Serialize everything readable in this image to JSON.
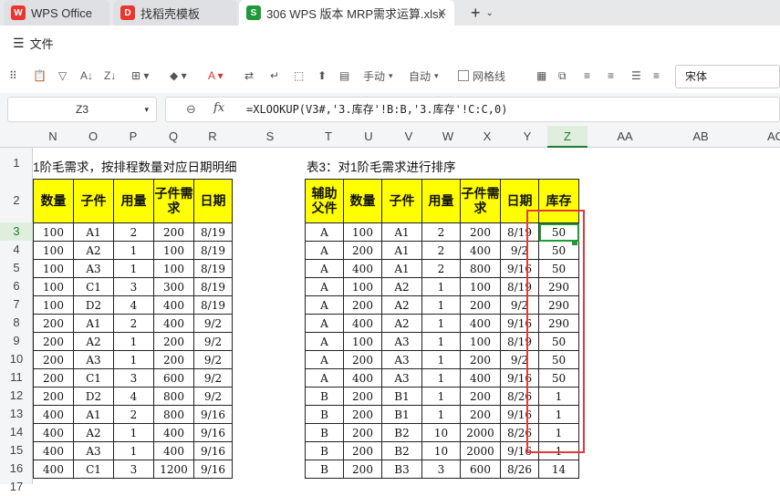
{
  "tabs": [
    {
      "label": "WPS Office",
      "icon": "wps-icon"
    },
    {
      "label": "找稻壳模板",
      "icon": "docer-icon"
    },
    {
      "label": "306 WPS 版本 MRP需求运算.xlsx",
      "icon": "spreadsheet-icon"
    }
  ],
  "menu": {
    "file": "文件"
  },
  "toolbar": {
    "wrap_mode": "手动",
    "auto": "自动",
    "gridlines": "网格线",
    "font": "宋体"
  },
  "formula_bar": {
    "cell_ref": "Z3",
    "fx": "fx",
    "formula": "=XLOOKUP(V3#,'3.库存'!B:B,'3.库存'!C:C,0)"
  },
  "columns": [
    "N",
    "O",
    "P",
    "Q",
    "R",
    "S",
    "T",
    "U",
    "V",
    "W",
    "X",
    "Y",
    "Z",
    "AA",
    "AB",
    "AC"
  ],
  "rows": [
    "1",
    "2",
    "3",
    "4",
    "5",
    "6",
    "7",
    "8",
    "9",
    "10",
    "11",
    "12",
    "13",
    "14",
    "15",
    "16",
    "17"
  ],
  "left_table": {
    "title": "1阶毛需求，按排程数量对应日期明细",
    "headers": [
      "数量",
      "子件",
      "用量",
      "子件需求",
      "日期"
    ],
    "rows": [
      [
        "100",
        "A1",
        "2",
        "200",
        "8/19"
      ],
      [
        "100",
        "A2",
        "1",
        "100",
        "8/19"
      ],
      [
        "100",
        "A3",
        "1",
        "100",
        "8/19"
      ],
      [
        "100",
        "C1",
        "3",
        "300",
        "8/19"
      ],
      [
        "100",
        "D2",
        "4",
        "400",
        "8/19"
      ],
      [
        "200",
        "A1",
        "2",
        "400",
        "9/2"
      ],
      [
        "200",
        "A2",
        "1",
        "200",
        "9/2"
      ],
      [
        "200",
        "A3",
        "1",
        "200",
        "9/2"
      ],
      [
        "200",
        "C1",
        "3",
        "600",
        "9/2"
      ],
      [
        "200",
        "D2",
        "4",
        "800",
        "9/2"
      ],
      [
        "400",
        "A1",
        "2",
        "800",
        "9/16"
      ],
      [
        "400",
        "A2",
        "1",
        "400",
        "9/16"
      ],
      [
        "400",
        "A3",
        "1",
        "400",
        "9/16"
      ],
      [
        "400",
        "C1",
        "3",
        "1200",
        "9/16"
      ]
    ]
  },
  "right_table": {
    "title": "表3：对1阶毛需求进行排序",
    "headers": [
      "辅助父件",
      "数量",
      "子件",
      "用量",
      "子件需求",
      "日期",
      "库存"
    ],
    "rows": [
      [
        "A",
        "100",
        "A1",
        "2",
        "200",
        "8/19",
        "50"
      ],
      [
        "A",
        "200",
        "A1",
        "2",
        "400",
        "9/2",
        "50"
      ],
      [
        "A",
        "400",
        "A1",
        "2",
        "800",
        "9/16",
        "50"
      ],
      [
        "A",
        "100",
        "A2",
        "1",
        "100",
        "8/19",
        "290"
      ],
      [
        "A",
        "200",
        "A2",
        "1",
        "200",
        "9/2",
        "290"
      ],
      [
        "A",
        "400",
        "A2",
        "1",
        "400",
        "9/16",
        "290"
      ],
      [
        "A",
        "100",
        "A3",
        "1",
        "100",
        "8/19",
        "50"
      ],
      [
        "A",
        "200",
        "A3",
        "1",
        "200",
        "9/2",
        "50"
      ],
      [
        "A",
        "400",
        "A3",
        "1",
        "400",
        "9/16",
        "50"
      ],
      [
        "B",
        "200",
        "B1",
        "1",
        "200",
        "8/26",
        "1"
      ],
      [
        "B",
        "200",
        "B1",
        "1",
        "200",
        "9/16",
        "1"
      ],
      [
        "B",
        "200",
        "B2",
        "10",
        "2000",
        "8/26",
        "1"
      ],
      [
        "B",
        "200",
        "B2",
        "10",
        "2000",
        "9/16",
        "1"
      ],
      [
        "B",
        "200",
        "B3",
        "3",
        "600",
        "8/26",
        "14"
      ]
    ]
  },
  "colors": {
    "header_fill": "#ffff00",
    "highlight_box": "#e03a3a",
    "selection": "#1f9a3a"
  }
}
